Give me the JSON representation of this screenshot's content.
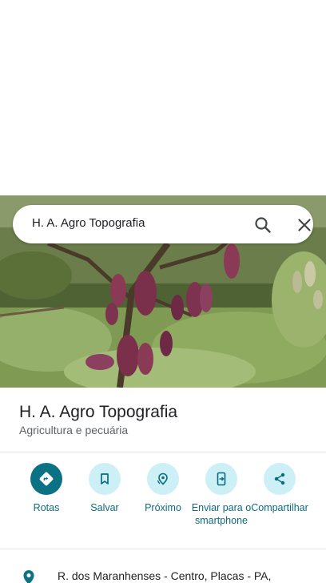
{
  "search": {
    "query": "H. A. Agro Topografia"
  },
  "place": {
    "name": "H. A. Agro Topografia",
    "category": "Agricultura e pecuária"
  },
  "actions": [
    {
      "label": "Rotas",
      "icon": "directions-icon"
    },
    {
      "label": "Salvar",
      "icon": "bookmark-icon"
    },
    {
      "label": "Próximo",
      "icon": "nearby-icon"
    },
    {
      "label": "Enviar para o smartphone",
      "icon": "send-to-phone-icon"
    },
    {
      "label": "Compartilhar",
      "icon": "share-icon"
    }
  ],
  "address": {
    "text": "R. dos Maranhenses - Centro, Placas - PA,"
  },
  "colors": {
    "accent": "#0b7285",
    "accent_light": "#cdf0f6",
    "label": "#0b6b7e"
  }
}
